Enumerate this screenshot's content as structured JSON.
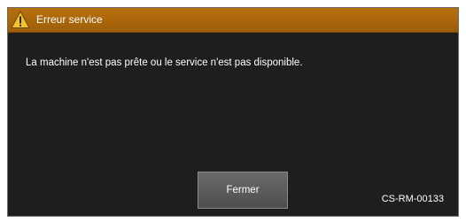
{
  "dialog": {
    "title": "Erreur service",
    "title_icon": "warning-icon",
    "message": "La machine n'est pas prête ou le service n'est pas disponible.",
    "close_label": "Fermer",
    "error_code": "CS-RM-00133"
  },
  "colors": {
    "titlebar": "#a86508",
    "background": "#1e1e1e",
    "button": "#5c5c5c",
    "warning_triangle": "#f2c230"
  }
}
